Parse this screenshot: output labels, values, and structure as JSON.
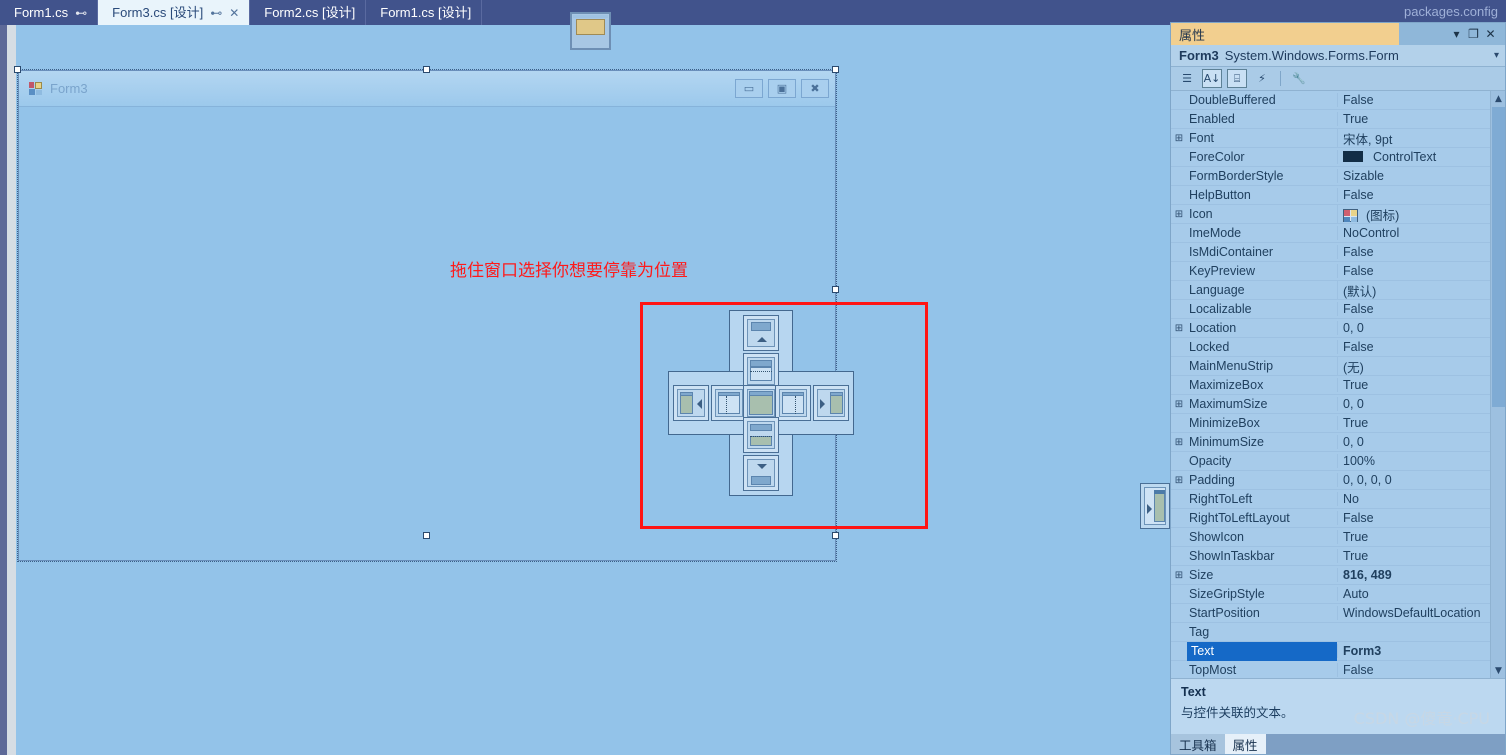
{
  "tabs": [
    {
      "label": "Form1.cs",
      "state": "inactive",
      "pin": "⊷",
      "close": ""
    },
    {
      "label": "Form3.cs [设计]",
      "state": "active",
      "pin": "⊷",
      "close": "✕"
    },
    {
      "label": "Form2.cs [设计]",
      "state": "inactive",
      "pin": "",
      "close": ""
    },
    {
      "label": "Form1.cs [设计]",
      "state": "inactive",
      "pin": "",
      "close": ""
    }
  ],
  "overflow_tab": "packages.config",
  "designer": {
    "form_title": "Form3",
    "minimize_glyph": "▭",
    "maximize_glyph": "▣",
    "close_glyph": "✖",
    "hint_text": "拖住窗口选择你想要停靠为位置"
  },
  "dock_guide": {
    "top_outer": "dock-top-outer",
    "top_inner": "dock-top-inner",
    "left_outer": "dock-left-outer",
    "left_inner": "dock-left-inner",
    "center": "dock-center",
    "right_inner": "dock-right-inner",
    "right_outer": "dock-right-outer",
    "bottom_inner": "dock-bottom-inner",
    "bottom_outer": "dock-bottom-outer"
  },
  "properties": {
    "panel_title": "属性",
    "dropdown_glyph": "▾",
    "maximize_glyph": "❐",
    "close_glyph": "✕",
    "object_name": "Form3",
    "object_type": "System.Windows.Forms.Form",
    "object_dropdown_glyph": "▾",
    "toolbar": {
      "categorized": "☰",
      "alphabetical": "A↓",
      "properties_page": "⌸",
      "events": "⚡",
      "property_pages": "🔧"
    },
    "scroll_up_glyph": "▲",
    "scroll_down_glyph": "▼",
    "expander_glyph": "⊞",
    "rows": [
      {
        "expandable": false,
        "name": "DoubleBuffered",
        "value": "False",
        "bold": false
      },
      {
        "expandable": false,
        "name": "Enabled",
        "value": "True",
        "bold": false
      },
      {
        "expandable": true,
        "name": "Font",
        "value": "宋体, 9pt",
        "bold": false
      },
      {
        "expandable": false,
        "name": "ForeColor",
        "value": "ControlText",
        "bold": false,
        "swatch": "#122d46"
      },
      {
        "expandable": false,
        "name": "FormBorderStyle",
        "value": "Sizable",
        "bold": false
      },
      {
        "expandable": false,
        "name": "HelpButton",
        "value": "False",
        "bold": false
      },
      {
        "expandable": true,
        "name": "Icon",
        "value": "(图标)",
        "bold": false,
        "icon_swatch": true
      },
      {
        "expandable": false,
        "name": "ImeMode",
        "value": "NoControl",
        "bold": false
      },
      {
        "expandable": false,
        "name": "IsMdiContainer",
        "value": "False",
        "bold": false
      },
      {
        "expandable": false,
        "name": "KeyPreview",
        "value": "False",
        "bold": false
      },
      {
        "expandable": false,
        "name": "Language",
        "value": "(默认)",
        "bold": false
      },
      {
        "expandable": false,
        "name": "Localizable",
        "value": "False",
        "bold": false
      },
      {
        "expandable": true,
        "name": "Location",
        "value": "0, 0",
        "bold": false
      },
      {
        "expandable": false,
        "name": "Locked",
        "value": "False",
        "bold": false
      },
      {
        "expandable": false,
        "name": "MainMenuStrip",
        "value": "(无)",
        "bold": false
      },
      {
        "expandable": false,
        "name": "MaximizeBox",
        "value": "True",
        "bold": false
      },
      {
        "expandable": true,
        "name": "MaximumSize",
        "value": "0, 0",
        "bold": false
      },
      {
        "expandable": false,
        "name": "MinimizeBox",
        "value": "True",
        "bold": false
      },
      {
        "expandable": true,
        "name": "MinimumSize",
        "value": "0, 0",
        "bold": false
      },
      {
        "expandable": false,
        "name": "Opacity",
        "value": "100%",
        "bold": false
      },
      {
        "expandable": true,
        "name": "Padding",
        "value": "0, 0, 0, 0",
        "bold": false
      },
      {
        "expandable": false,
        "name": "RightToLeft",
        "value": "No",
        "bold": false
      },
      {
        "expandable": false,
        "name": "RightToLeftLayout",
        "value": "False",
        "bold": false
      },
      {
        "expandable": false,
        "name": "ShowIcon",
        "value": "True",
        "bold": false
      },
      {
        "expandable": false,
        "name": "ShowInTaskbar",
        "value": "True",
        "bold": false
      },
      {
        "expandable": true,
        "name": "Size",
        "value": "816, 489",
        "bold": true
      },
      {
        "expandable": false,
        "name": "SizeGripStyle",
        "value": "Auto",
        "bold": false
      },
      {
        "expandable": false,
        "name": "StartPosition",
        "value": "WindowsDefaultLocation",
        "bold": false
      },
      {
        "expandable": false,
        "name": "Tag",
        "value": "",
        "bold": false
      },
      {
        "expandable": false,
        "name": "Text",
        "value": "Form3",
        "bold": true,
        "selected": true
      },
      {
        "expandable": false,
        "name": "TopMost",
        "value": "False",
        "bold": false
      }
    ],
    "description_title": "Text",
    "description_body": "与控件关联的文本。",
    "bottom_tabs": [
      {
        "label": "工具箱",
        "selected": false
      },
      {
        "label": "属性",
        "selected": true
      }
    ]
  },
  "watermark": "CSDN @傻竜·CPU"
}
